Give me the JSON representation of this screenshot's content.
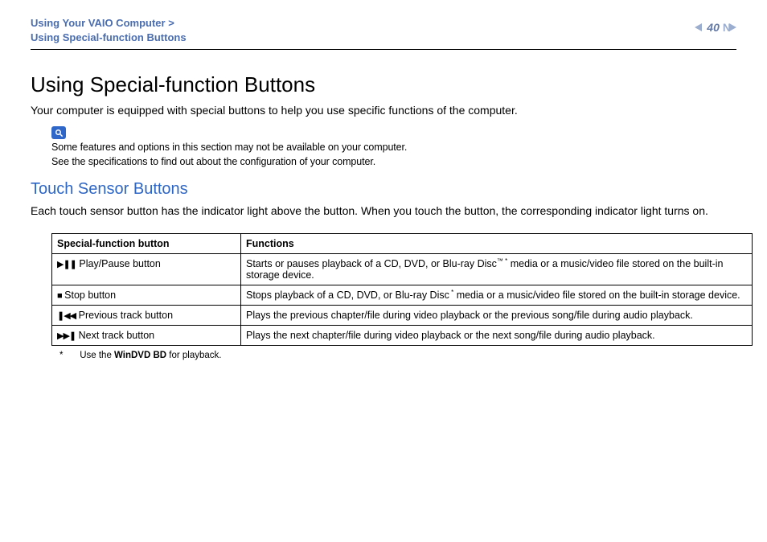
{
  "header": {
    "crumb_parent": "Using Your VAIO Computer",
    "crumb_sep": " >",
    "crumb_current": "Using Special-function Buttons",
    "page_number": "40"
  },
  "content": {
    "h1": "Using Special-function Buttons",
    "intro": "Your computer is equipped with special buttons to help you use specific functions of the computer.",
    "note_line1": "Some features and options in this section may not be available on your computer.",
    "note_line2": "See the specifications to find out about the configuration of your computer.",
    "h2": "Touch Sensor Buttons",
    "sub_intro": "Each touch sensor button has the indicator light above the button. When you touch the button, the corresponding indicator light turns on."
  },
  "table": {
    "head_button": "Special-function button",
    "head_functions": "Functions",
    "rows": [
      {
        "icon": "▶❚❚",
        "label": " Play/Pause button",
        "func_pre": "Starts or pauses playback of a CD, DVD, or Blu-ray Disc",
        "tm": "™",
        "star": "*",
        "func_post": " media or a music/video file stored on the built-in storage device."
      },
      {
        "icon": "■",
        "label": " Stop button",
        "func_pre": "Stops playback of a CD, DVD, or Blu-ray Disc",
        "tm": "",
        "star": "*",
        "func_post": " media or a music/video file stored on the built-in storage device."
      },
      {
        "icon": "❚◀◀",
        "label": " Previous track button",
        "func_pre": "Plays the previous chapter/file during video playback or the previous song/file during audio playback.",
        "tm": "",
        "star": "",
        "func_post": ""
      },
      {
        "icon": "▶▶❚",
        "label": " Next track button",
        "func_pre": "Plays the next chapter/file during video playback or the next song/file during audio playback.",
        "tm": "",
        "star": "",
        "func_post": ""
      }
    ]
  },
  "footnote": {
    "star": "*",
    "text_pre": "Use the ",
    "bold": "WinDVD BD",
    "text_post": " for playback."
  }
}
